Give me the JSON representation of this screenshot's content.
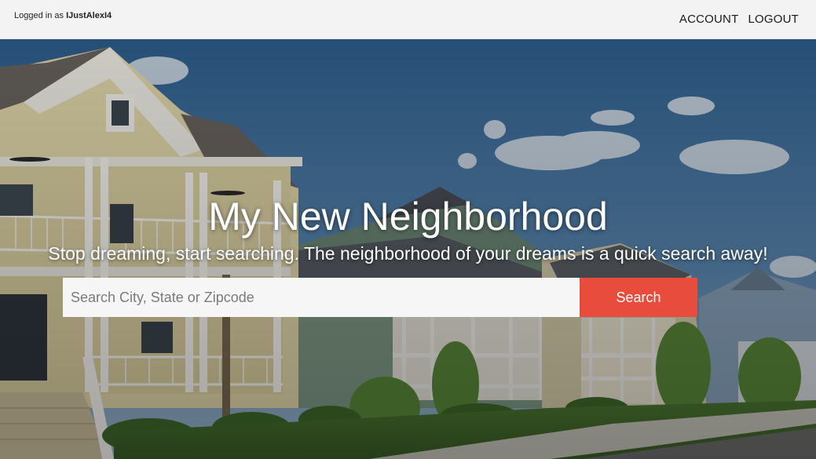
{
  "header": {
    "logged_in_prefix": "Logged in as ",
    "username": "IJustAlexI4",
    "nav": {
      "account_label": "ACCOUNT",
      "logout_label": "LOGOUT"
    }
  },
  "hero": {
    "title": "My New Neighborhood",
    "subtitle": "Stop dreaming, start searching. The neighborhood of your dreams is a quick search away!",
    "background_image": "photo-of-suburban-houses-street"
  },
  "search": {
    "placeholder": "Search City, State or Zipcode",
    "value": "",
    "button_label": "Search"
  },
  "colors": {
    "topbar_bg": "#f3f3f3",
    "search_button": "#e74c3c",
    "hero_text": "#ffffff"
  }
}
